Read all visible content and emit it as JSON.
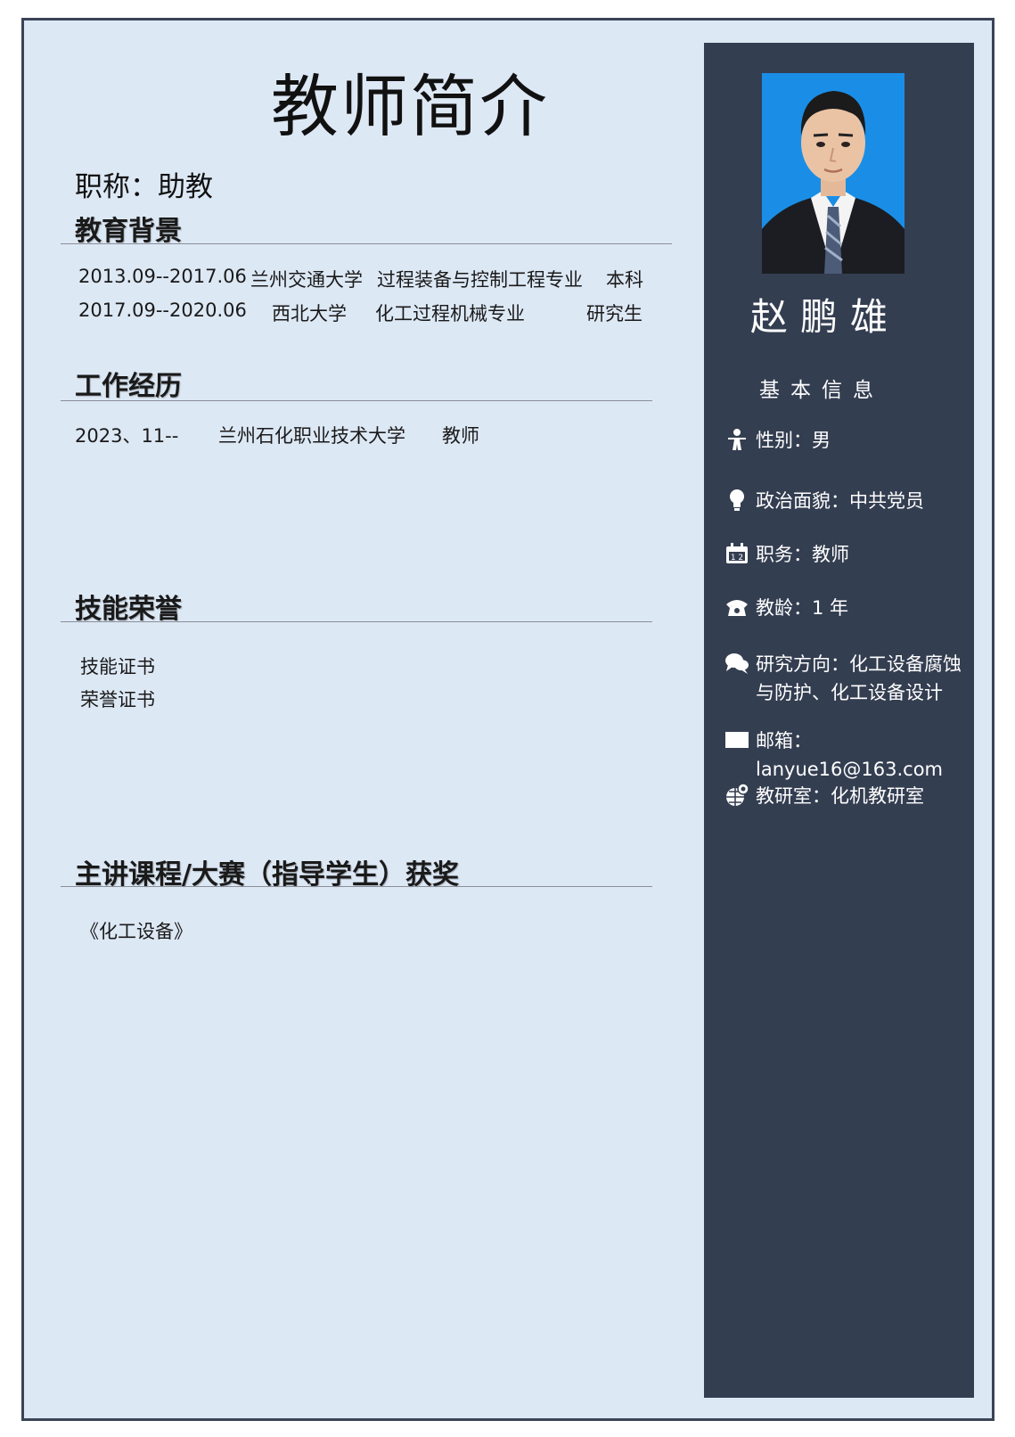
{
  "title": "教师简介",
  "position_line": "职称：助教",
  "sections": {
    "education": {
      "title": "教育背景",
      "rows": [
        {
          "period": "2013.09--2017.06",
          "school": "兰州交通大学",
          "major": "过程装备与控制工程专业",
          "degree": "本科"
        },
        {
          "period": "2017.09--2020.06",
          "school": "西北大学",
          "major": "化工过程机械专业",
          "degree": "研究生"
        }
      ]
    },
    "work": {
      "title": "工作经历",
      "rows": [
        {
          "period": "2023、11--",
          "org": "兰州石化职业技术大学",
          "role": "教师"
        }
      ]
    },
    "honors": {
      "title": "技能荣誉",
      "items": [
        "技能证书",
        "荣誉证书"
      ]
    },
    "courses": {
      "title": "主讲课程/大赛（指导学生）获奖",
      "items": [
        "《化工设备》"
      ]
    }
  },
  "sidebar": {
    "name": "赵鹏雄",
    "info_heading": "基本信息",
    "items": [
      {
        "icon": "person-icon",
        "text": "性别：男"
      },
      {
        "icon": "lightbulb-icon",
        "text": "政治面貌：中共党员"
      },
      {
        "icon": "calendar-icon",
        "text": "职务：教师"
      },
      {
        "icon": "phone-icon",
        "text": "教龄：1 年"
      },
      {
        "icon": "chat-icon",
        "text": "研究方向：化工设备腐蚀与防护、化工设备设计"
      },
      {
        "icon": "envelope-icon",
        "text": "邮箱：lanyue16@163.com"
      },
      {
        "icon": "globe-icon",
        "text": "教研室：化机教研室"
      }
    ]
  },
  "colors": {
    "page_background": "#dde8f5",
    "sidebar_background": "#343e51",
    "photo_background": "#1a8ee6",
    "frame_border": "#3a4456"
  }
}
